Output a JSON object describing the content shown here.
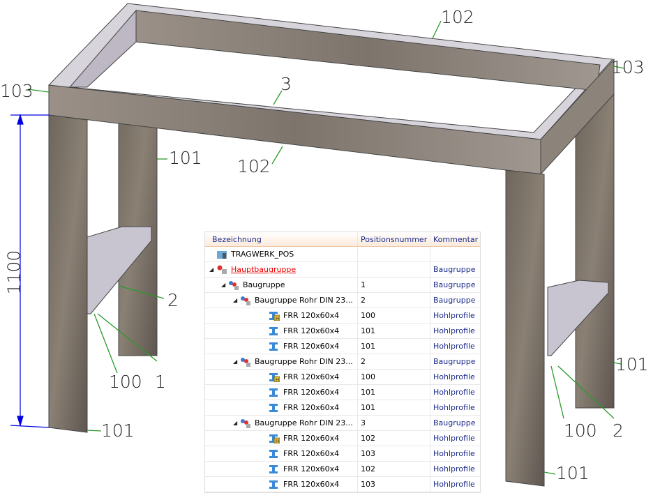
{
  "drawing": {
    "labels": {
      "tl103": "103",
      "top102": "102",
      "tr103": "103",
      "front3": "3",
      "l101": "101",
      "front102": "102",
      "dim": "1100",
      "l2": "2",
      "l100": "100",
      "l1": "1",
      "bl101": "101",
      "r101": "101",
      "r100": "100",
      "r2": "2",
      "br101": "101"
    },
    "colors": {
      "dimension": "#0000e0",
      "leader": "#2a9a2a"
    }
  },
  "table": {
    "headers": [
      "Bezeichnung",
      "Positionsnummer",
      "Kommentar"
    ],
    "rows": [
      {
        "name": "TRAGWERK_POS",
        "pos": "",
        "comment": "",
        "level": 0,
        "icon": "database-icon",
        "expand": false
      },
      {
        "name": "Hauptbaugruppe",
        "pos": "",
        "comment": "Baugruppe",
        "level": 1,
        "icon": "main-assembly-icon",
        "expand": true,
        "highlight": true
      },
      {
        "name": "Baugruppe",
        "pos": "1",
        "comment": "Baugruppe",
        "level": 2,
        "icon": "assembly-icon",
        "expand": true
      },
      {
        "name": "Baugruppe Rohr DIN 23...",
        "pos": "2",
        "comment": "Baugruppe",
        "level": 3,
        "icon": "assembly-icon",
        "expand": true
      },
      {
        "name": "FRR 120x60x4",
        "pos": "100",
        "comment": "Hohlprofile",
        "level": 4,
        "icon": "beam-main-icon"
      },
      {
        "name": "FRR 120x60x4",
        "pos": "101",
        "comment": "Hohlprofile",
        "level": 4,
        "icon": "beam-icon"
      },
      {
        "name": "FRR 120x60x4",
        "pos": "101",
        "comment": "Hohlprofile",
        "level": 4,
        "icon": "beam-icon"
      },
      {
        "name": "Baugruppe Rohr DIN 23...",
        "pos": "2",
        "comment": "Baugruppe",
        "level": 3,
        "icon": "assembly-icon",
        "expand": true
      },
      {
        "name": "FRR 120x60x4",
        "pos": "100",
        "comment": "Hohlprofile",
        "level": 4,
        "icon": "beam-main-icon"
      },
      {
        "name": "FRR 120x60x4",
        "pos": "101",
        "comment": "Hohlprofile",
        "level": 4,
        "icon": "beam-icon"
      },
      {
        "name": "FRR 120x60x4",
        "pos": "101",
        "comment": "Hohlprofile",
        "level": 4,
        "icon": "beam-icon"
      },
      {
        "name": "Baugruppe Rohr DIN 23...",
        "pos": "3",
        "comment": "Baugruppe",
        "level": 3,
        "icon": "assembly-icon",
        "expand": true
      },
      {
        "name": "FRR 120x60x4",
        "pos": "102",
        "comment": "Hohlprofile",
        "level": 4,
        "icon": "beam-main-icon"
      },
      {
        "name": "FRR 120x60x4",
        "pos": "103",
        "comment": "Hohlprofile",
        "level": 4,
        "icon": "beam-icon"
      },
      {
        "name": "FRR 120x60x4",
        "pos": "102",
        "comment": "Hohlprofile",
        "level": 4,
        "icon": "beam-icon"
      },
      {
        "name": "FRR 120x60x4",
        "pos": "103",
        "comment": "Hohlprofile",
        "level": 4,
        "icon": "beam-icon"
      }
    ]
  }
}
